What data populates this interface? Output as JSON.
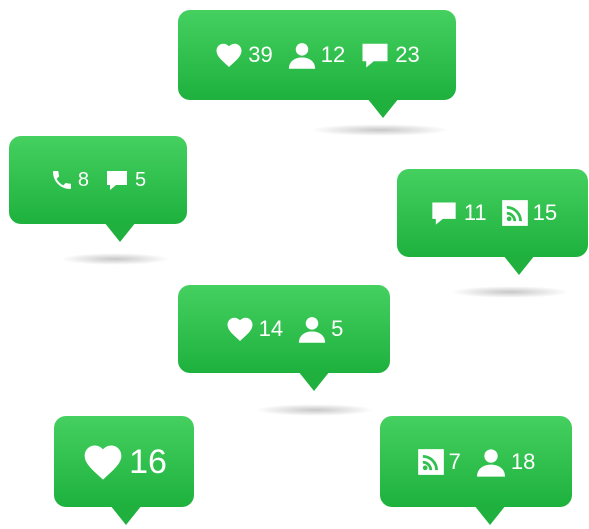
{
  "bubbles": [
    {
      "stats": [
        {
          "icon": "heart-icon",
          "value": "39"
        },
        {
          "icon": "user-icon",
          "value": "12"
        },
        {
          "icon": "comment-icon",
          "value": "23"
        }
      ]
    },
    {
      "stats": [
        {
          "icon": "phone-icon",
          "value": "8"
        },
        {
          "icon": "comment-icon",
          "value": "5"
        }
      ]
    },
    {
      "stats": [
        {
          "icon": "comment-icon",
          "value": "11"
        },
        {
          "icon": "rss-icon",
          "value": "15"
        }
      ]
    },
    {
      "stats": [
        {
          "icon": "heart-icon",
          "value": "14"
        },
        {
          "icon": "user-icon",
          "value": "5"
        }
      ]
    },
    {
      "stats": [
        {
          "icon": "heart-icon",
          "value": "16"
        }
      ]
    },
    {
      "stats": [
        {
          "icon": "rss-icon",
          "value": "7"
        },
        {
          "icon": "user-icon",
          "value": "18"
        }
      ]
    }
  ],
  "colors": {
    "bubble_top": "#45d060",
    "bubble_bottom": "#1eb13d",
    "text": "#ffffff"
  }
}
